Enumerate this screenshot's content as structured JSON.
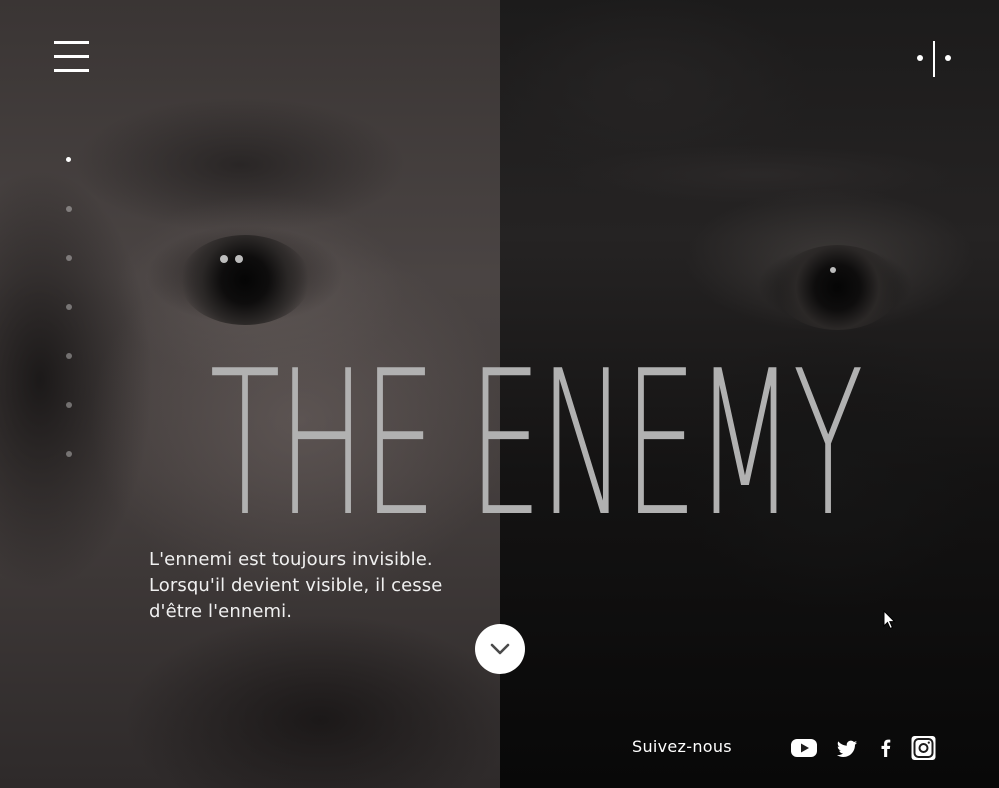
{
  "hero": {
    "title": "THE ENEMY",
    "tagline_lines": [
      "L'ennemi est toujours invisible.",
      "Lorsqu'il devient visible, il cesse",
      "d'être l'ennemi."
    ]
  },
  "header": {
    "menu_icon": "hamburger-menu-icon",
    "logo_icon": "dot-bar-dot-logo"
  },
  "section_nav": {
    "count": 7,
    "active_index": 0
  },
  "scroll": {
    "icon": "chevron-down-icon"
  },
  "footer": {
    "follow_label": "Suivez-nous",
    "social": [
      {
        "icon": "youtube-icon"
      },
      {
        "icon": "twitter-icon"
      },
      {
        "icon": "facebook-icon"
      },
      {
        "icon": "instagram-icon"
      }
    ]
  },
  "colors": {
    "title": "#b1b1b1",
    "text": "#ffffff",
    "left_panel": "#4a4443",
    "right_panel": "#1c1b1b"
  }
}
